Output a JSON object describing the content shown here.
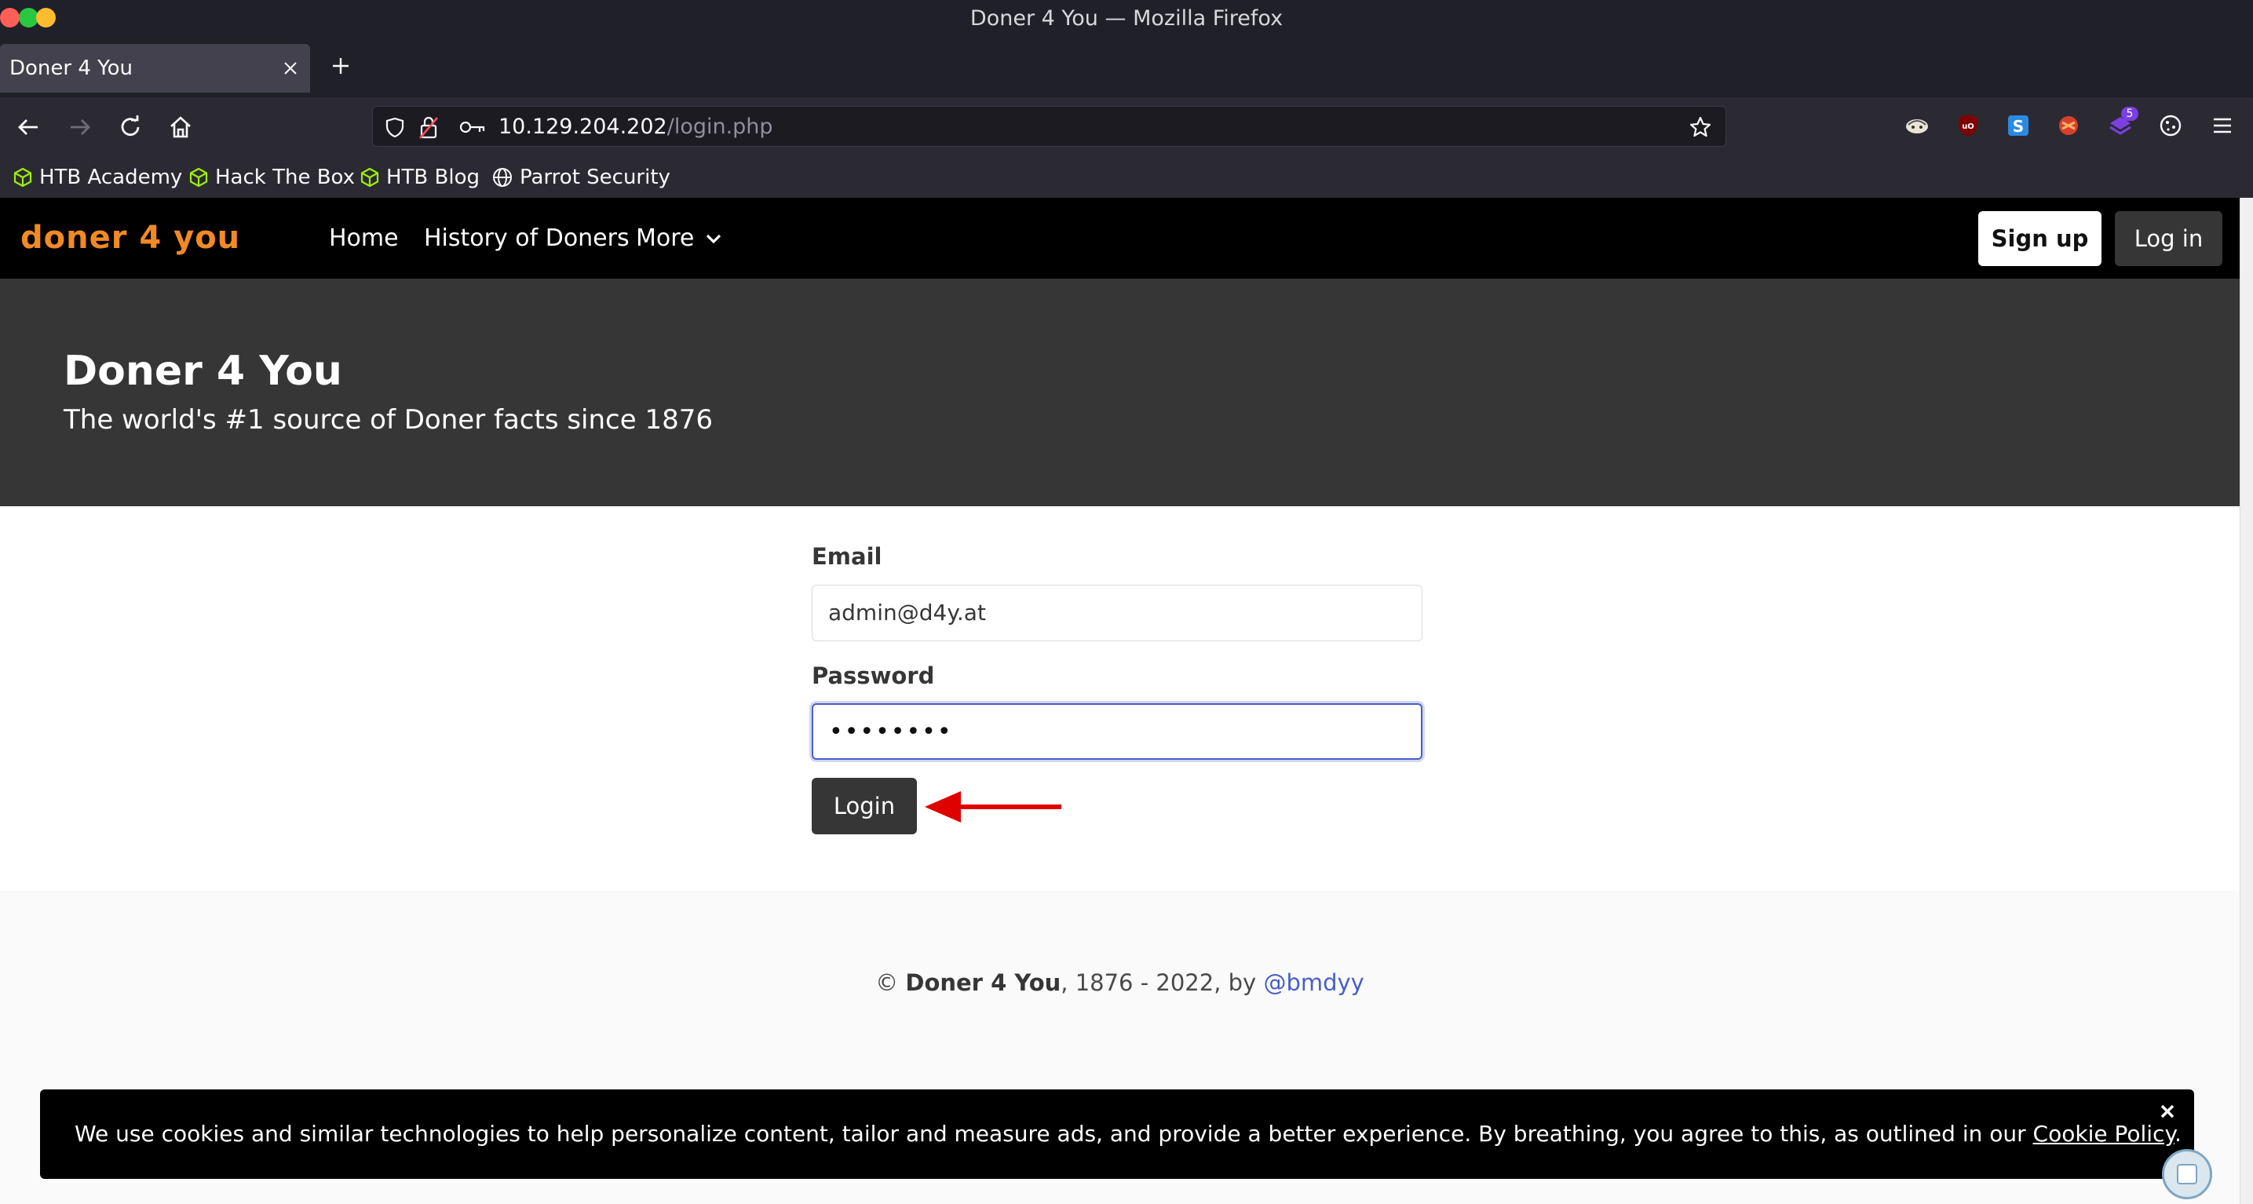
{
  "window": {
    "title": "Doner 4 You — Mozilla Firefox",
    "traffic_lights": {
      "close": "#ff5f57",
      "maximize": "#28c840",
      "minimize": "#febc2e"
    }
  },
  "tabs": [
    {
      "title": "Doner 4 You",
      "active": true
    }
  ],
  "address_bar": {
    "host": "10.129.204.202",
    "path": "/login.php"
  },
  "extensions": [
    "spoof-icon",
    "ublock-icon",
    "s-icon",
    "addon-red-icon",
    "addon-purple-icon",
    "cookie-icon"
  ],
  "extension_badge": "5",
  "bookmarks": [
    {
      "label": "HTB Academy",
      "icon": "cube-icon"
    },
    {
      "label": "Hack The Box",
      "icon": "cube-icon"
    },
    {
      "label": "HTB Blog",
      "icon": "cube-icon"
    },
    {
      "label": "Parrot Security",
      "icon": "globe-icon"
    }
  ],
  "site": {
    "logo": "doner 4 you",
    "nav": {
      "home": "Home",
      "history": "History of Doners",
      "more": "More",
      "signup": "Sign up",
      "login": "Log in"
    },
    "hero": {
      "title": "Doner 4 You",
      "subtitle": "The world's #1 source of Doner facts since 1876"
    },
    "form": {
      "email_label": "Email",
      "email_value": "admin@d4y.at",
      "password_label": "Password",
      "password_value": "••••••••",
      "submit": "Login"
    },
    "footer": {
      "prefix": "© ",
      "brand": "Doner 4 You",
      "middle": ", 1876 - 2022, by ",
      "author": "@bmdyy"
    },
    "cookie_banner": {
      "text": "We use cookies and similar technologies to help personalize content, tailor and measure ads, and provide a better experience. By breathing, you agree to this, as outlined in our ",
      "link": "Cookie Policy",
      "suffix": "."
    }
  },
  "colors": {
    "accent_orange": "#f08a24",
    "link_blue": "#485fc7",
    "annotation_red": "#e00000"
  }
}
